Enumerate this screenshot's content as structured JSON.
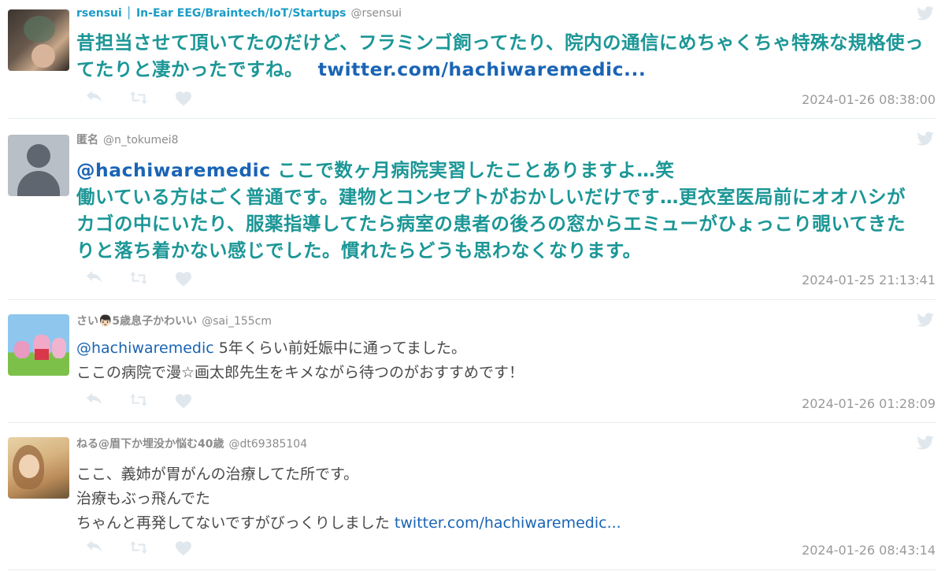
{
  "tweets": [
    {
      "name": "rsensui │ In-Ear EEG/Braintech/IoT/Startups",
      "handle": "@rsensui",
      "text": "昔担当させて頂いてたのだけど、フラミンゴ飼ってたり、院内の通信にめちゃくちゃ特殊な規格使ってたりと凄かったですね。",
      "link": "twitter.com/hachiwaremedic...",
      "date": "2024-01-26 08:38:00",
      "avatar": "photo-avatar-dark"
    },
    {
      "name": "匿名",
      "handle": "@n_tokumei8",
      "mention": "@hachiwaremedic",
      "line1": "ここで数ヶ月病院実習したことありますよ…笑",
      "line2": "働いている方はごく普通です。建物とコンセプトがおかしいだけです…更衣室医局前にオオハシがカゴの中にいたり、服薬指導してたら病室の患者の後ろの窓からエミューがひょっこり覗いてきたりと落ち着かない感じでした。慣れたらどうも思わなくなります。",
      "date": "2024-01-25 21:13:41",
      "avatar": "default-person-avatar"
    },
    {
      "name": "さい👦🏻5歳息子かわいい",
      "handle": "@sai_155cm",
      "mention": "@hachiwaremedic",
      "line1": "5年くらい前妊娠中に通ってました。",
      "line2": "ここの病院で漫☆画太郎先生をキメながら待つのがおすすめです！",
      "date": "2024-01-26 01:28:09",
      "avatar": "cartoon-pigs-avatar"
    },
    {
      "name": "ねる@眉下か埋没か悩む40歳",
      "handle": "@dt69385104",
      "line1": "ここ、義姉が胃がんの治療してた所です。",
      "line2": "治療もぶっ飛んでた",
      "line3": "ちゃんと再発してないですがびっくりしました",
      "link": "twitter.com/hachiwaremedic...",
      "date": "2024-01-26 08:43:14",
      "avatar": "photo-avatar-woman"
    }
  ],
  "icons": {
    "bird": "twitter-bird-icon",
    "reply": "reply-icon",
    "retweet": "retweet-icon",
    "like": "heart-icon"
  },
  "colors": {
    "accent": "#1c9696",
    "link": "#1a64b4",
    "name_accent": "#1a9cc7",
    "muted": "#9a9a9a"
  }
}
